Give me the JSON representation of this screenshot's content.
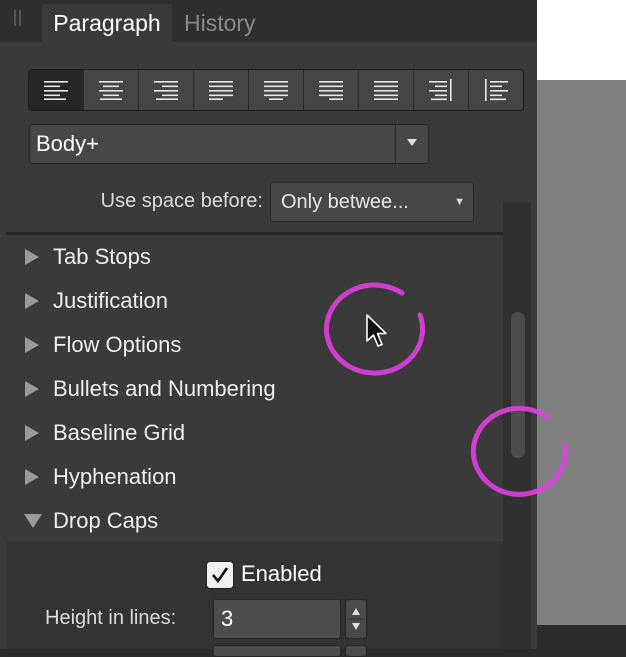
{
  "tabs": [
    {
      "label": "Paragraph",
      "active": true
    },
    {
      "label": "History",
      "active": false
    }
  ],
  "alignment": {
    "buttons": [
      "align-left",
      "align-center",
      "align-right",
      "justify-left",
      "justify-center",
      "justify-right",
      "justify-all",
      "align-towards-spine",
      "align-away-from-spine"
    ],
    "selected": "align-left"
  },
  "style_select": {
    "value": "Body+"
  },
  "spacing": {
    "label": "Use space before:",
    "value": "Only betwee..."
  },
  "sections": [
    {
      "label": "Tab Stops",
      "expanded": false
    },
    {
      "label": "Justification",
      "expanded": false
    },
    {
      "label": "Flow Options",
      "expanded": false
    },
    {
      "label": "Bullets and Numbering",
      "expanded": false
    },
    {
      "label": "Baseline Grid",
      "expanded": false
    },
    {
      "label": "Hyphenation",
      "expanded": false
    },
    {
      "label": "Drop Caps",
      "expanded": true
    }
  ],
  "drop_caps": {
    "enabled_label": "Enabled",
    "enabled": true,
    "height_label": "Height in lines:",
    "height_value": "3"
  },
  "colors": {
    "panel": "#3a3a3a",
    "highlight": "#e040e0",
    "canvas": "#808080"
  }
}
